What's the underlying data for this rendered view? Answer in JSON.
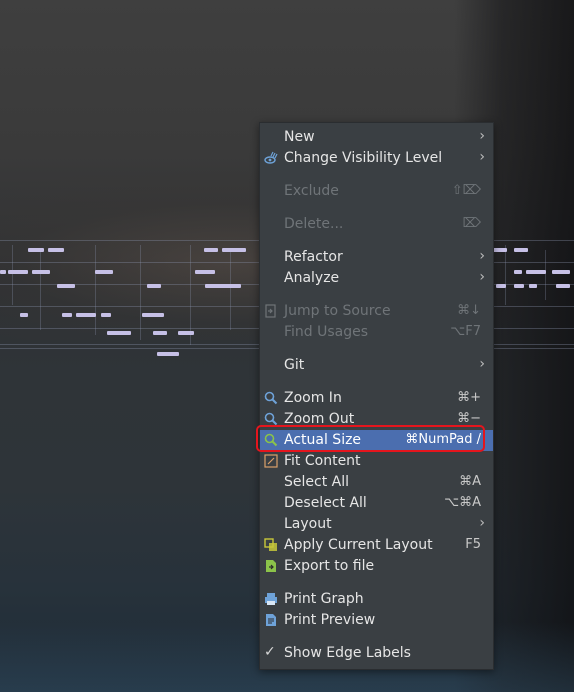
{
  "menu": {
    "items": [
      {
        "label": "New",
        "shortcut": "",
        "submenu": true,
        "disabled": false,
        "icon": ""
      },
      {
        "label": "Change Visibility Level",
        "shortcut": "",
        "submenu": true,
        "disabled": false,
        "icon": "visibility-icon"
      },
      {
        "label": "Exclude",
        "shortcut": "⇧⌦",
        "submenu": false,
        "disabled": true,
        "icon": ""
      },
      {
        "label": "Delete...",
        "shortcut": "⌦",
        "submenu": false,
        "disabled": true,
        "icon": ""
      },
      {
        "label": "Refactor",
        "shortcut": "",
        "submenu": true,
        "disabled": false,
        "icon": ""
      },
      {
        "label": "Analyze",
        "shortcut": "",
        "submenu": true,
        "disabled": false,
        "icon": ""
      },
      {
        "label": "Jump to Source",
        "shortcut": "⌘↓",
        "submenu": false,
        "disabled": true,
        "icon": "jump-source-icon"
      },
      {
        "label": "Find Usages",
        "shortcut": "⌥F7",
        "submenu": false,
        "disabled": true,
        "icon": ""
      },
      {
        "label": "Git",
        "shortcut": "",
        "submenu": true,
        "disabled": false,
        "icon": ""
      },
      {
        "label": "Zoom In",
        "shortcut": "⌘+",
        "submenu": false,
        "disabled": false,
        "icon": "zoom-in-icon"
      },
      {
        "label": "Zoom Out",
        "shortcut": "⌘−",
        "submenu": false,
        "disabled": false,
        "icon": "zoom-out-icon"
      },
      {
        "label": "Actual Size",
        "shortcut": "⌘NumPad /",
        "submenu": false,
        "disabled": false,
        "icon": "actual-size-icon",
        "selected": true
      },
      {
        "label": "Fit Content",
        "shortcut": "",
        "submenu": false,
        "disabled": false,
        "icon": "fit-content-icon"
      },
      {
        "label": "Select All",
        "shortcut": "⌘A",
        "submenu": false,
        "disabled": false,
        "icon": ""
      },
      {
        "label": "Deselect All",
        "shortcut": "⌥⌘A",
        "submenu": false,
        "disabled": false,
        "icon": ""
      },
      {
        "label": "Layout",
        "shortcut": "",
        "submenu": true,
        "disabled": false,
        "icon": ""
      },
      {
        "label": "Apply Current Layout",
        "shortcut": "F5",
        "submenu": false,
        "disabled": false,
        "icon": "apply-layout-icon"
      },
      {
        "label": "Export to file",
        "shortcut": "",
        "submenu": false,
        "disabled": false,
        "icon": "export-icon"
      },
      {
        "label": "Print Graph",
        "shortcut": "",
        "submenu": false,
        "disabled": false,
        "icon": "print-icon"
      },
      {
        "label": "Print Preview",
        "shortcut": "",
        "submenu": false,
        "disabled": false,
        "icon": "print-preview-icon"
      },
      {
        "label": "Show Edge Labels",
        "shortcut": "",
        "submenu": false,
        "disabled": false,
        "icon": "checkmark-icon",
        "checked": true
      }
    ]
  },
  "colors": {
    "menu_bg": "#3a3f43",
    "selected_bg": "#4b6eaf",
    "highlight_border": "#e5151d",
    "node_color": "#c6c0e6"
  }
}
